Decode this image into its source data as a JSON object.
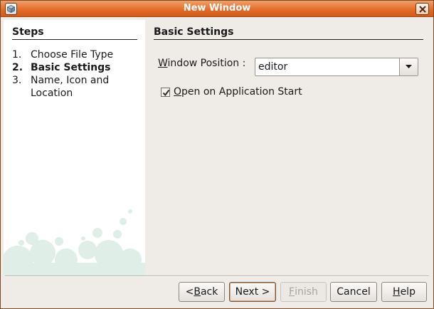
{
  "window": {
    "title": "New Window"
  },
  "steps": {
    "heading": "Steps",
    "items": [
      {
        "num": "1.",
        "label": "Choose File Type"
      },
      {
        "num": "2.",
        "label": "Basic Settings"
      },
      {
        "num": "3.",
        "label": "Name, Icon and Location"
      }
    ]
  },
  "settings": {
    "heading": "Basic Settings",
    "window_position_label_first": "W",
    "window_position_label_rest": "indow Position :",
    "window_position_value": "editor",
    "open_on_start_checked": true,
    "open_on_start_label_first": "O",
    "open_on_start_label_rest": "pen on Application Start"
  },
  "buttons": {
    "back_prefix": "< ",
    "back_mn": "B",
    "back_rest": "ack",
    "next_label": "Next >",
    "finish_mn": "F",
    "finish_rest": "inish",
    "cancel_label": "Cancel",
    "help_mn": "H",
    "help_rest": "elp"
  },
  "colors": {
    "titlebar": "#e46d2c",
    "dialog_bg": "#efebe7",
    "bubbles": "#dfeee6"
  }
}
